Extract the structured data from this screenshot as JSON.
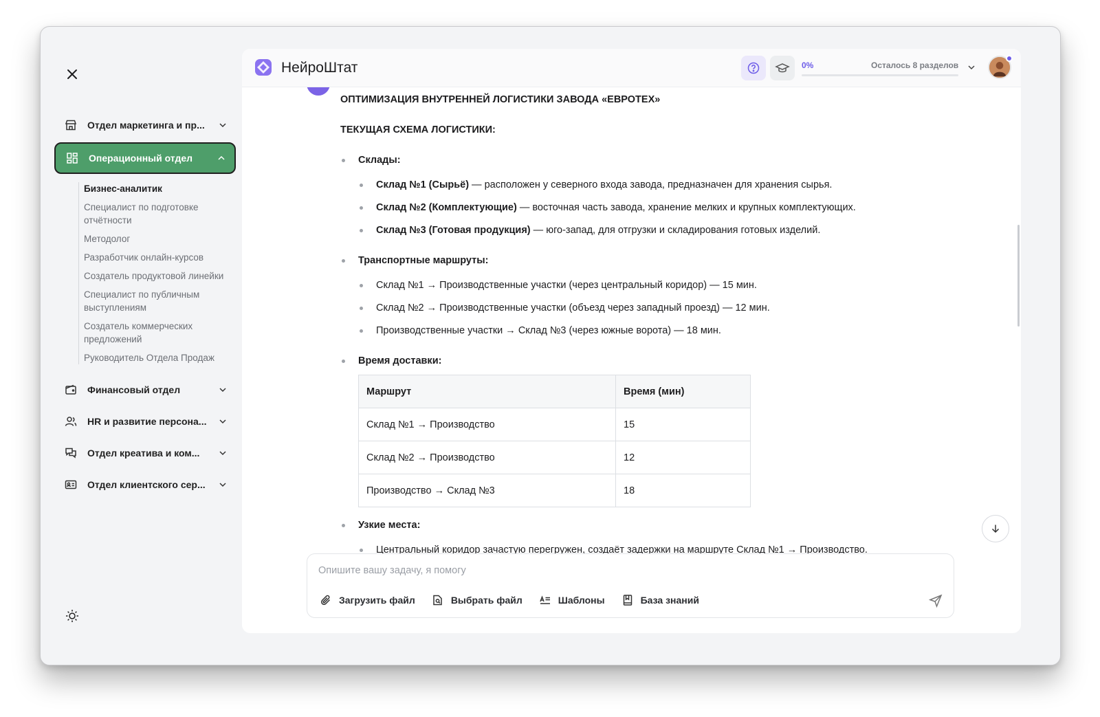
{
  "app": {
    "brand": "НейроШтат"
  },
  "sidebar": {
    "items": [
      {
        "label": "Отдел маркетинга и пр...",
        "icon": "store-icon"
      },
      {
        "label": "Операционный отдел",
        "icon": "grid-icon",
        "active": true
      },
      {
        "label": "Финансовый отдел",
        "icon": "wallet-icon"
      },
      {
        "label": "HR и развитие персона...",
        "icon": "users-icon"
      },
      {
        "label": "Отдел креатива и ком...",
        "icon": "chat-icon"
      },
      {
        "label": "Отдел клиентского сер...",
        "icon": "id-card-icon"
      }
    ],
    "subitems": [
      "Бизнес-аналитик",
      "Специалист по подготовке отчётности",
      "Методолог",
      "Разработчик онлайн-курсов",
      "Создатель продуктовой линейки",
      "Специалист по публичным выступлениям",
      "Создатель коммерческих предложений",
      "Руководитель Отдела Продаж"
    ]
  },
  "header": {
    "progress_pct": "0%",
    "progress_value": 0,
    "remaining": "Осталось 8 разделов"
  },
  "doc": {
    "title": "ОПТИМИЗАЦИЯ ВНУТРЕННЕЙ ЛОГИСТИКИ ЗАВОДА «ЕВРОТЕХ»",
    "subtitle": "ТЕКУЩАЯ СХЕМА ЛОГИСТИКИ:",
    "warehouses_heading": "Склады:",
    "warehouses": [
      {
        "name": "Склад №1 (Сырьё)",
        "text": " — расположен у северного входа завода, предназначен для хранения сырья."
      },
      {
        "name": "Склад №2 (Комплектующие)",
        "text": " — восточная часть завода, хранение мелких и крупных комплектующих."
      },
      {
        "name": "Склад №3 (Готовая продукция)",
        "text": " — юго-запад, для отгрузки и складирования готовых изделий."
      }
    ],
    "routes_heading": "Транспортные маршруты:",
    "routes": [
      "Склад №1 → Производственные участки (через центральный коридор) — 15 мин.",
      "Склад №2 → Производственные участки (объезд через западный проезд) — 12 мин.",
      "Производственные участки → Склад №3 (через южные ворота) — 18 мин."
    ],
    "delivery_heading": "Время доставки:",
    "table": {
      "headers": [
        "Маршрут",
        "Время (мин)"
      ],
      "rows": [
        [
          "Склад №1 → Производство",
          "15"
        ],
        [
          "Склад №2 → Производство",
          "12"
        ],
        [
          "Производство → Склад №3",
          "18"
        ]
      ]
    },
    "bottlenecks_heading": "Узкие места:",
    "bottlenecks": [
      "Центральный коридор зачастую перегружен, создаёт задержки на маршруте Склад №1 → Производство."
    ]
  },
  "composer": {
    "placeholder": "Опишите вашу задачу, я помогу",
    "tools": [
      {
        "label": "Загрузить файл",
        "icon": "paperclip-icon"
      },
      {
        "label": "Выбрать файл",
        "icon": "file-search-icon"
      },
      {
        "label": "Шаблоны",
        "icon": "template-icon"
      },
      {
        "label": "База знаний",
        "icon": "book-icon"
      }
    ]
  },
  "colors": {
    "accent": "#6d5ce8",
    "active_nav": "#4e9e6a"
  }
}
